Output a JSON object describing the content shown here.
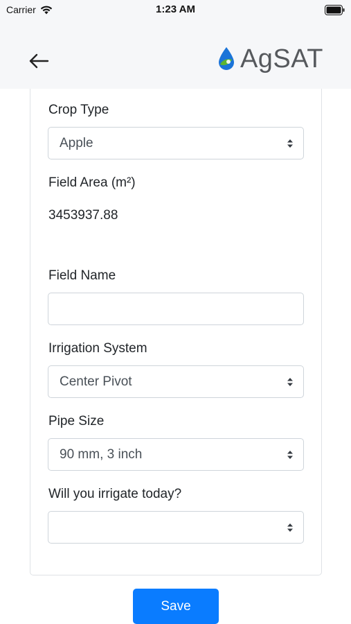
{
  "status": {
    "carrier": "Carrier",
    "time": "1:23 AM"
  },
  "header": {
    "logo_text": "AgSAT"
  },
  "form": {
    "crop_type": {
      "label": "Crop Type",
      "value": "Apple"
    },
    "field_area": {
      "label": "Field Area (m²)",
      "value": "3453937.88"
    },
    "field_name": {
      "label": "Field Name",
      "value": "",
      "placeholder": ""
    },
    "irrigation_system": {
      "label": "Irrigation System",
      "value": "Center Pivot"
    },
    "pipe_size": {
      "label": "Pipe Size",
      "value": "90 mm, 3 inch"
    },
    "irrigate_today": {
      "label": "Will you irrigate today?",
      "value": ""
    }
  },
  "actions": {
    "save_label": "Save"
  },
  "colors": {
    "primary": "#0a7cff",
    "header_bg": "#f6f7f9",
    "logo_drop_blue": "#1b74d8",
    "logo_leaf_green": "#5cb531"
  },
  "icons": [
    "wifi-icon",
    "battery-icon",
    "back-arrow-icon",
    "agsat-logo-icon",
    "select-caret-icon"
  ]
}
